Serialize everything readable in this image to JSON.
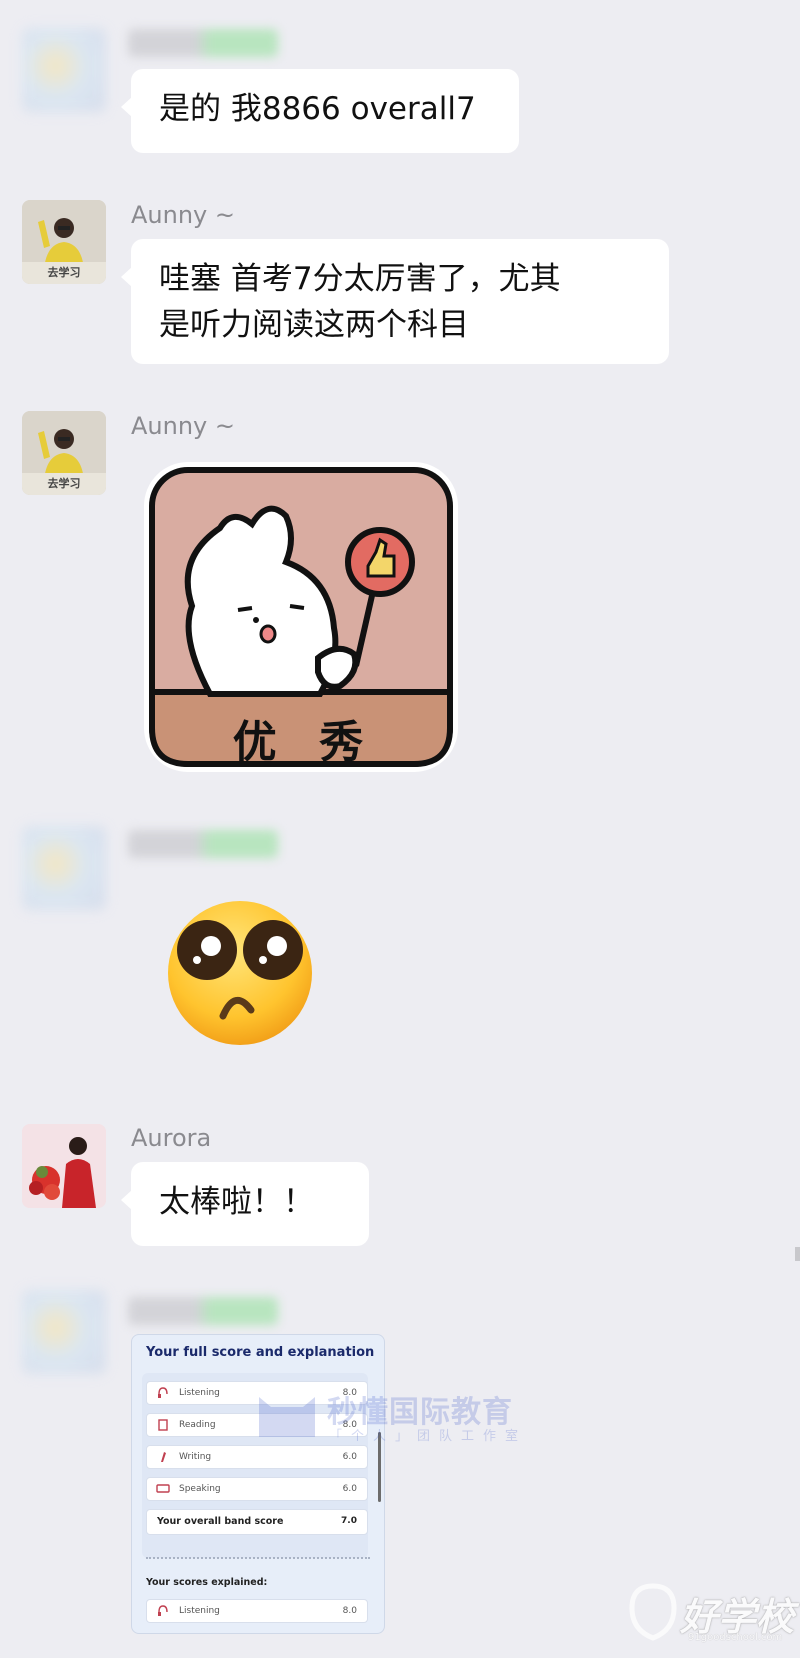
{
  "messages": [
    {
      "sender": "",
      "text_lines": [
        "是的 我8866 overall7"
      ]
    },
    {
      "sender": "Aunny ~",
      "avatar_caption": "去学习",
      "text_lines": [
        "哇塞 首考7分太厉害了，尤其",
        "是听力阅读这两个科目"
      ]
    },
    {
      "sender": "Aunny ~",
      "avatar_caption": "去学习",
      "sticker": {
        "icon": "bunny-thumbs-up-sticker",
        "caption": "优  秀"
      }
    },
    {
      "sender": "",
      "sticker": {
        "icon": "pleading-face-emoji"
      }
    },
    {
      "sender": "Aurora",
      "text_lines": [
        "太棒啦！！"
      ]
    },
    {
      "sender": "",
      "image": "score-report-screenshot"
    }
  ],
  "score_card": {
    "title": "Your full score and explanation",
    "rows": [
      {
        "label": "Listening",
        "value": "8.0",
        "icon": "headphone-icon"
      },
      {
        "label": "Reading",
        "value": "8.0",
        "icon": "book-icon"
      },
      {
        "label": "Writing",
        "value": "6.0",
        "icon": "pen-icon"
      },
      {
        "label": "Speaking",
        "value": "6.0",
        "icon": "speech-icon"
      }
    ],
    "overall_label": "Your overall band score",
    "overall_value": "7.0",
    "explained_label": "Your scores explained:",
    "explained_row": {
      "label": "Listening",
      "value": "8.0"
    }
  },
  "watermark": {
    "title": "秒懂国际教育",
    "subtitle": "「个人」团队工作室"
  },
  "site_logo": {
    "text": "好学校",
    "url": "91goodschool.com"
  },
  "colors": {
    "background": "#ededf2",
    "bubble": "#ffffff",
    "sender_name": "#8a8a8f"
  }
}
